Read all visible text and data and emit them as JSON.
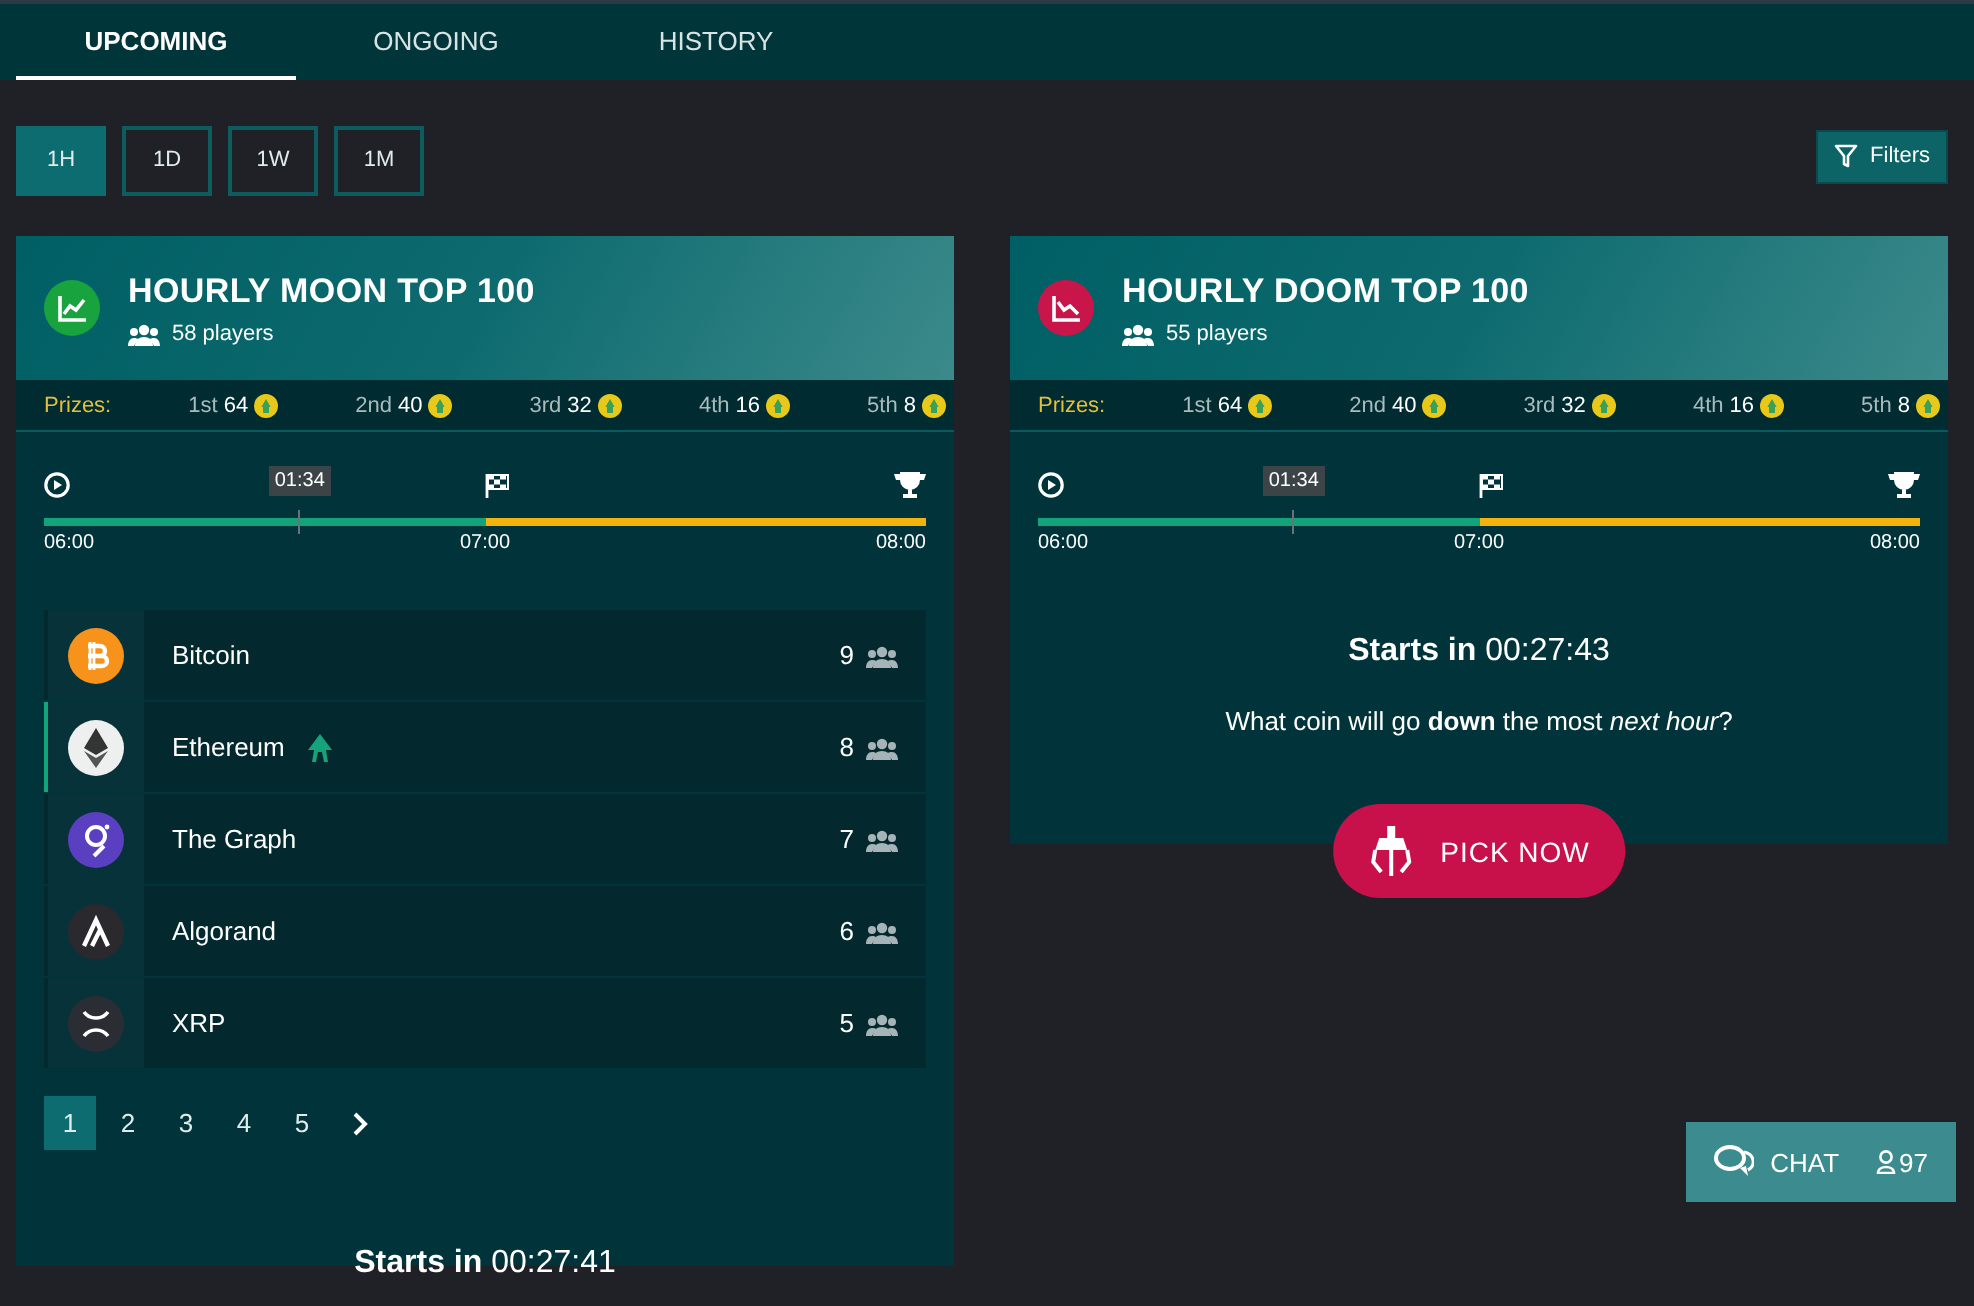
{
  "tabs": [
    {
      "label": "UPCOMING",
      "selected": true
    },
    {
      "label": "ONGOING",
      "selected": false
    },
    {
      "label": "HISTORY",
      "selected": false
    }
  ],
  "periods": [
    {
      "label": "1H",
      "selected": true
    },
    {
      "label": "1D",
      "selected": false
    },
    {
      "label": "1W",
      "selected": false
    },
    {
      "label": "1M",
      "selected": false
    }
  ],
  "filters_button": {
    "label": "Filters"
  },
  "contests": [
    {
      "kind": "moon",
      "title": "HOURLY MOON TOP 100",
      "players": "58 players",
      "prizes_label": "Prizes:",
      "prizes": [
        {
          "place": "1st",
          "amount": "64"
        },
        {
          "place": "2nd",
          "amount": "40"
        },
        {
          "place": "3rd",
          "amount": "32"
        },
        {
          "place": "4th",
          "amount": "16"
        },
        {
          "place": "5th",
          "amount": "8"
        }
      ],
      "timeline": {
        "level": 0.5,
        "marker": {
          "label": "01:34",
          "level": 0.29
        },
        "times": [
          "06:00",
          "07:00",
          "08:00"
        ]
      },
      "coins": [
        {
          "kind": "bitcoin",
          "name": "Bitcoin",
          "count": "9",
          "selected": false
        },
        {
          "kind": "ethereum",
          "name": "Ethereum",
          "count": "8",
          "selected": true
        },
        {
          "kind": "graph",
          "name": "The Graph",
          "count": "7",
          "selected": false
        },
        {
          "kind": "algorand",
          "name": "Algorand",
          "count": "6",
          "selected": false
        },
        {
          "kind": "xrp",
          "name": "XRP",
          "count": "5",
          "selected": false
        }
      ],
      "pages": [
        {
          "label": "1",
          "selected": true
        },
        {
          "label": "2",
          "selected": false
        },
        {
          "label": "3",
          "selected": false
        },
        {
          "label": "4",
          "selected": false
        },
        {
          "label": "5",
          "selected": false
        }
      ],
      "starts_label": "Starts in",
      "countdown": "00:27:41"
    },
    {
      "kind": "doom",
      "title": "HOURLY DOOM TOP 100",
      "players": "55 players",
      "prizes_label": "Prizes:",
      "prizes": [
        {
          "place": "1st",
          "amount": "64"
        },
        {
          "place": "2nd",
          "amount": "40"
        },
        {
          "place": "3rd",
          "amount": "32"
        },
        {
          "place": "4th",
          "amount": "16"
        },
        {
          "place": "5th",
          "amount": "8"
        }
      ],
      "timeline": {
        "level": 0.5,
        "marker": {
          "label": "01:34",
          "level": 0.29
        },
        "times": [
          "06:00",
          "07:00",
          "08:00"
        ]
      },
      "starts_label": "Starts in",
      "countdown": "00:27:43",
      "question": "What coin will go **down** the most *next hour*?",
      "pick_button": {
        "label": "PICK NOW"
      }
    }
  ],
  "chat": {
    "label": "CHAT",
    "count": "97"
  }
}
